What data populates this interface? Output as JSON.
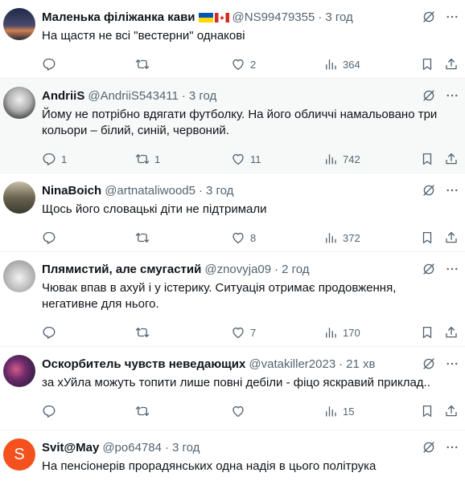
{
  "tweets": [
    {
      "name": "Маленька філіжанка кави",
      "handle": "@NS99479355",
      "time": "3 год",
      "text": "На щастя не всі \"вестерни\" однакові",
      "reply_count": "",
      "retweet_count": "",
      "like_count": "2",
      "view_count": "364",
      "avatar_color": "#3b3b55"
    },
    {
      "name": "AndriiS",
      "handle": "@AndriiS543411",
      "time": "3 год",
      "text": "Йому не потрібно вдягати футболку. На його обличчі намальовано три кольори – білий, синій, червоний.",
      "reply_count": "1",
      "retweet_count": "1",
      "like_count": "11",
      "view_count": "742",
      "avatar_color": "#d9d9d9"
    },
    {
      "name": "NinaBoich",
      "handle": "@artnataliwood5",
      "time": "3 год",
      "text": "Щось його словацькі діти не підтримали",
      "reply_count": "",
      "retweet_count": "",
      "like_count": "8",
      "view_count": "372",
      "avatar_color": "#8a8470"
    },
    {
      "name": "Плямистий, але смугастий",
      "handle": "@znovyja09",
      "time": "2 год",
      "text": "Чювак впав в ахуй і у істерику. Ситуація отримає продовження, негативне для нього.",
      "reply_count": "",
      "retweet_count": "",
      "like_count": "7",
      "view_count": "170",
      "avatar_color": "#c9c9c9"
    },
    {
      "name": "Оскорбитель чувств неведающих",
      "handle": "@vatakiller2023",
      "time": "21 хв",
      "text": "за хУйла можуть топити лише повні дебіли - фіцо яскравий приклад..",
      "reply_count": "",
      "retweet_count": "",
      "like_count": "",
      "view_count": "15",
      "avatar_color": "#4a2a55"
    },
    {
      "name": "Svit@May",
      "handle": "@po64784",
      "time": "3 год",
      "text": "На пенсіонерів прорадянських одна надія в цього політрука",
      "avatar_letter": "S",
      "avatar_color": "#f4511e"
    }
  ],
  "colors": {
    "muted": "#536471",
    "text": "#0f1419",
    "highlight_bg": "#f7f9f9"
  },
  "icons": {
    "reply": "reply-icon",
    "retweet": "retweet-icon",
    "like": "like-icon",
    "views": "views-icon",
    "bookmark": "bookmark-icon",
    "share": "share-icon",
    "grok": "grok-icon",
    "more": "more-icon"
  }
}
